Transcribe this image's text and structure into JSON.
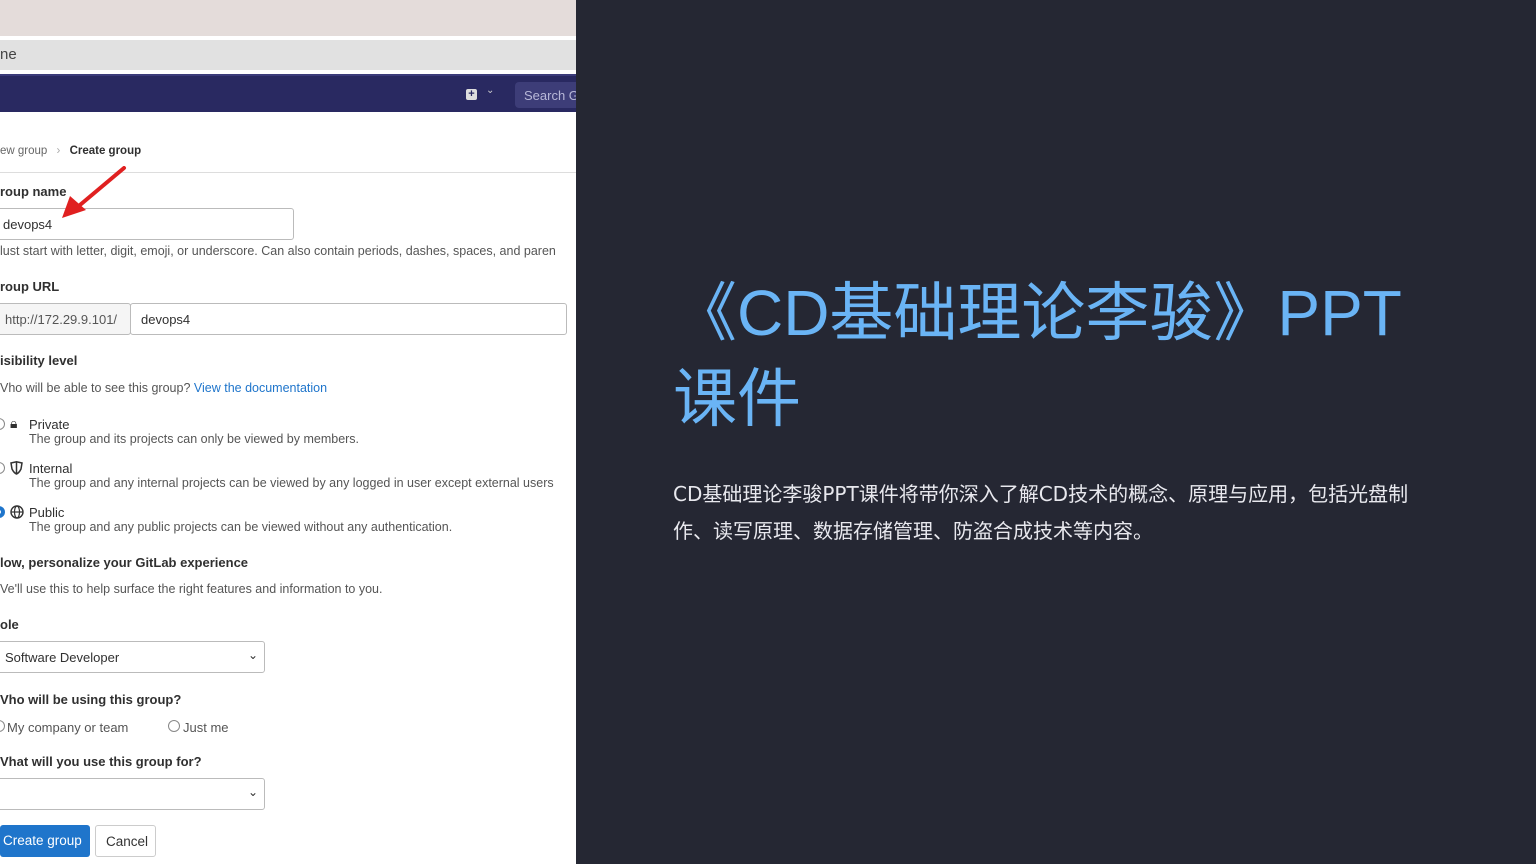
{
  "browser": {
    "tab_fragment": "ne"
  },
  "navbar": {
    "search_placeholder": "Search G",
    "new_icon": "plus-square-icon"
  },
  "breadcrumb": {
    "parent": "ew group",
    "current": "Create group"
  },
  "form": {
    "group_name_label": "roup name",
    "group_name_value": "devops4",
    "group_name_help": "lust start with letter, digit, emoji, or underscore. Can also contain periods, dashes, spaces, and paren",
    "group_url_label": "roup URL",
    "url_prefix": "http://172.29.9.101/",
    "url_value": "devops4",
    "visibility_label": "isibility level",
    "visibility_help": "Vho will be able to see this group?",
    "doc_link": "View the documentation",
    "visibility_options": [
      {
        "label": "Private",
        "desc": "The group and its projects can only be viewed by members.",
        "icon": "lock-icon",
        "selected": false
      },
      {
        "label": "Internal",
        "desc": "The group and any internal projects can be viewed by any logged in user except external users",
        "icon": "shield-icon",
        "selected": false
      },
      {
        "label": "Public",
        "desc": "The group and any public projects can be viewed without any authentication.",
        "icon": "globe-icon",
        "selected": true
      }
    ],
    "personalize_heading": "low, personalize your GitLab experience",
    "personalize_help": "Ve'll use this to help surface the right features and information to you.",
    "role_label": "ole",
    "role_value": "Software Developer",
    "who_label": "Vho will be using this group?",
    "who_options": [
      "My company or team",
      "Just me"
    ],
    "use_label": "Vhat will you use this group for?",
    "use_value": "",
    "create_button": "Create group",
    "cancel_button": "Cancel"
  },
  "slide": {
    "title": "《CD基础理论李骏》PPT课件",
    "description": "CD基础理论李骏PPT课件将带你深入了解CD技术的概念、原理与应用，包括光盘制作、读写原理、数据存储管理、防盗合成技术等内容。"
  },
  "colors": {
    "background": "#252733",
    "title": "#6ab4f5",
    "navbar": "#292961",
    "primary_button": "#1f75cb",
    "arrow": "#e02020"
  }
}
